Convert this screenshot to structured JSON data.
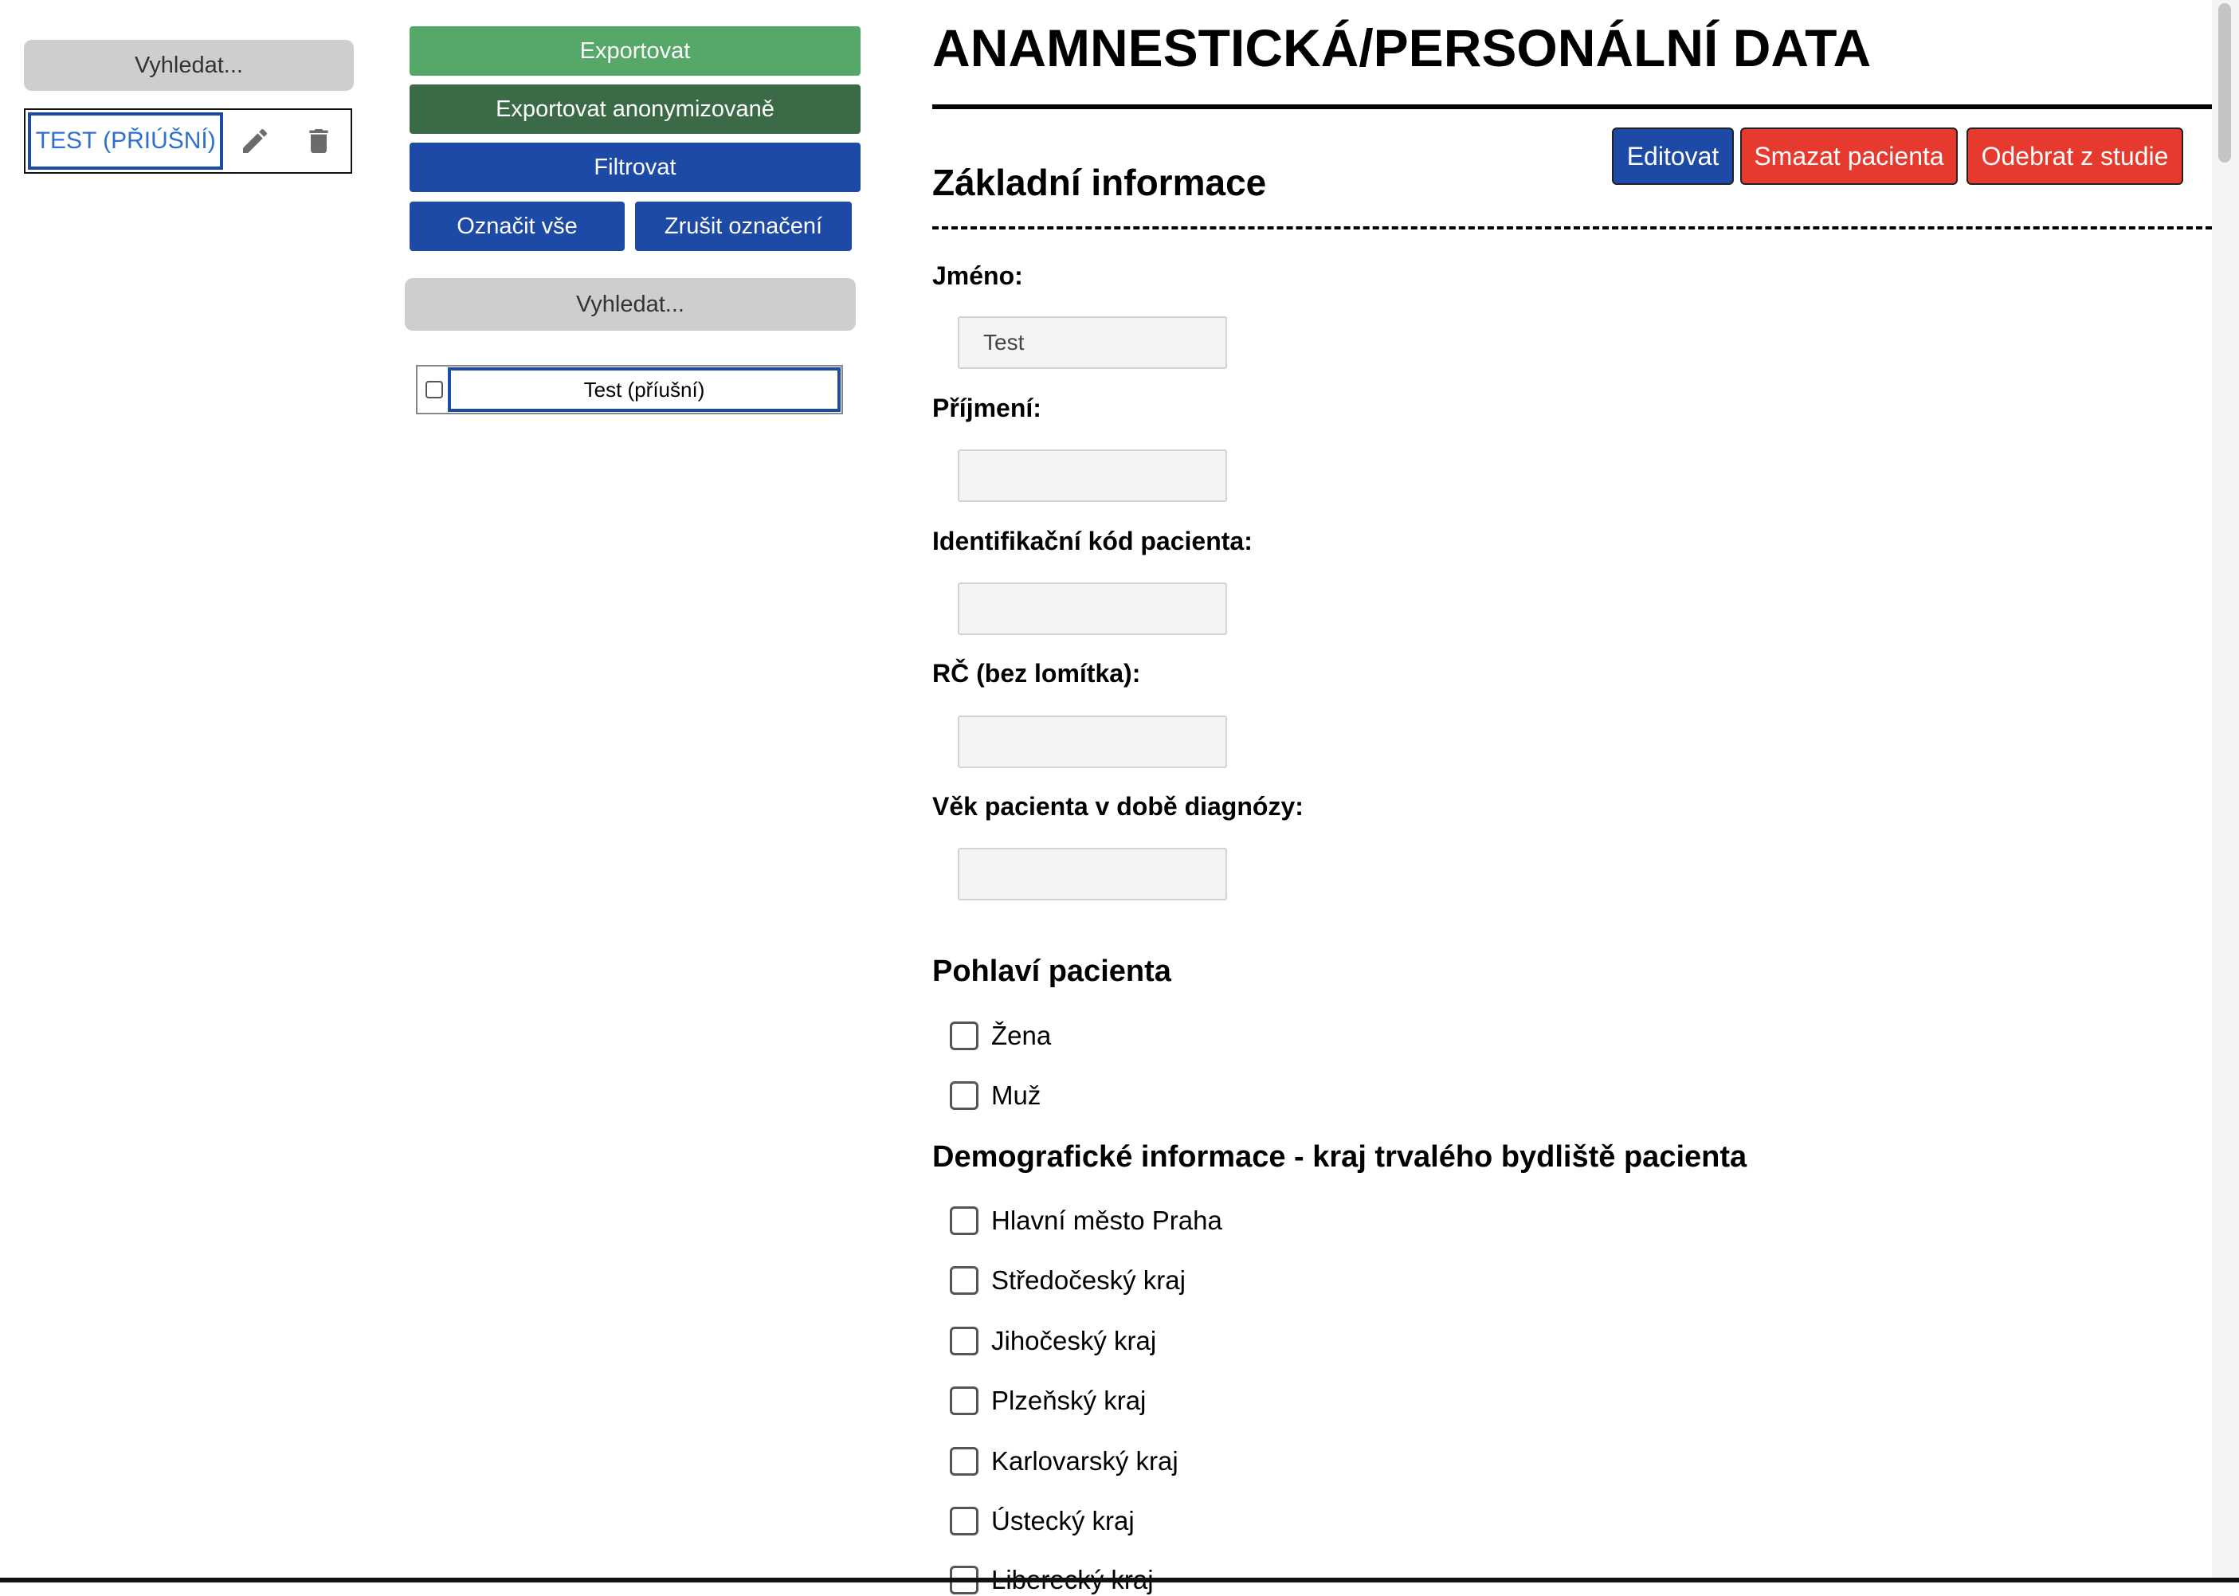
{
  "sidebar": {
    "search_label": "Vyhledat...",
    "patient_name": "TEST (PŘIÚŠNÍ)"
  },
  "toolbar": {
    "export_label": "Exportovat",
    "export_anon_label": "Exportovat anonymizovaně",
    "filter_label": "Filtrovat",
    "select_all_label": "Označit vše",
    "deselect_all_label": "Zrušit označení",
    "search_label": "Vyhledat...",
    "list_item_label": "Test (příušní)"
  },
  "main": {
    "title": "ANAMNESTICKÁ/PERSONÁLNÍ DATA",
    "actions": {
      "edit_label": "Editovat",
      "delete_label": "Smazat pacienta",
      "remove_label": "Odebrat z studie"
    },
    "section_title": "Základní informace",
    "fields": [
      {
        "label": "Jméno:",
        "value": "Test"
      },
      {
        "label": "Příjmení:",
        "value": ""
      },
      {
        "label": "Identifikační kód pacienta:",
        "value": ""
      },
      {
        "label": "RČ (bez lomítka):",
        "value": ""
      },
      {
        "label": "Věk pacienta v době diagnózy:",
        "value": ""
      }
    ],
    "gender": {
      "title": "Pohlaví pacienta",
      "options": [
        "Žena",
        "Muž"
      ]
    },
    "region": {
      "title": "Demografické informace - kraj trvalého bydliště pacienta",
      "options": [
        "Hlavní město Praha",
        "Středočeský kraj",
        "Jihočeský kraj",
        "Plzeňský kraj",
        "Karlovarský kraj",
        "Ústecký kraj",
        "Liberecký kraj"
      ]
    }
  },
  "colors": {
    "export_green": "#55a868",
    "export_anon_green": "#3a6b46",
    "primary_blue": "#1d49a7",
    "danger_red": "#e63a2e",
    "search_gray": "#cecece"
  }
}
